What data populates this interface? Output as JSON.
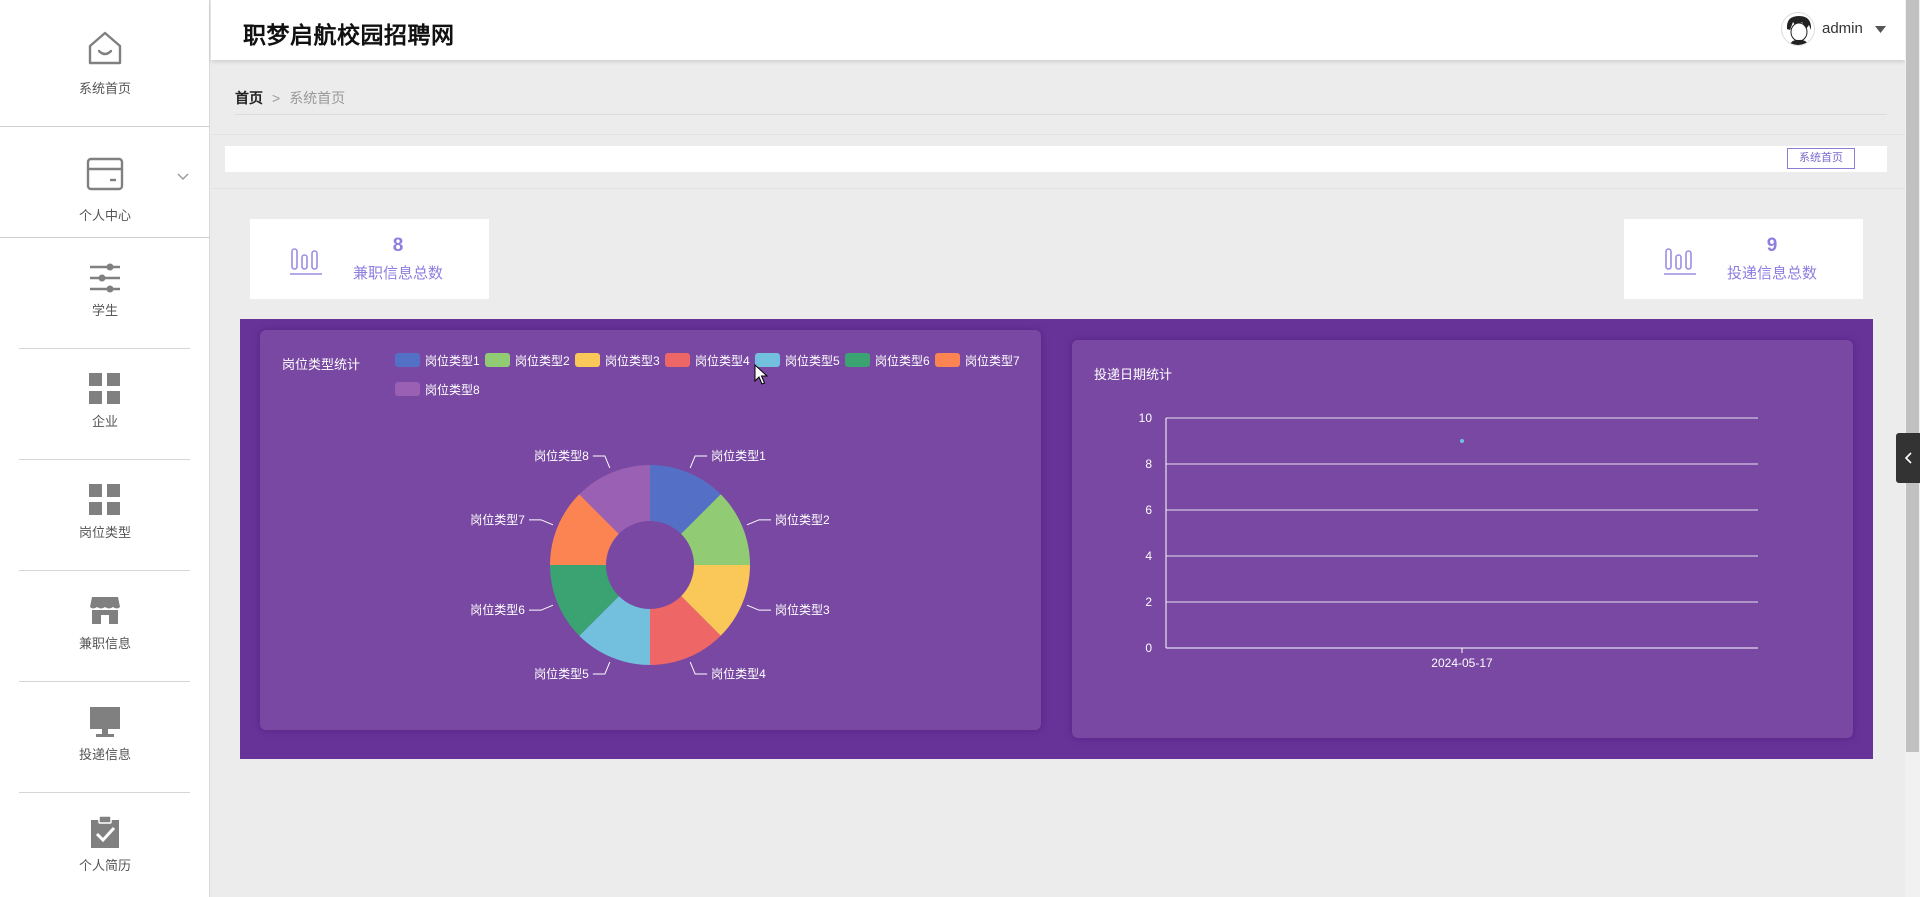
{
  "app": {
    "title": "职梦启航校园招聘网"
  },
  "user": {
    "name": "admin"
  },
  "sidebar": {
    "items": [
      {
        "label": "系统首页",
        "icon": "home-icon"
      },
      {
        "label": "个人中心",
        "icon": "wallet-icon"
      },
      {
        "label": "学生",
        "icon": "sliders-icon"
      },
      {
        "label": "企业",
        "icon": "grid-icon"
      },
      {
        "label": "岗位类型",
        "icon": "grid-icon"
      },
      {
        "label": "兼职信息",
        "icon": "store-icon"
      },
      {
        "label": "投递信息",
        "icon": "monitor-icon"
      },
      {
        "label": "个人简历",
        "icon": "clipboard-check-icon"
      }
    ]
  },
  "breadcrumb": {
    "home": "首页",
    "separator": ">",
    "current": "系统首页"
  },
  "tabs": {
    "active": "系统首页"
  },
  "stats": [
    {
      "value": "8",
      "label": "兼职信息总数",
      "icon": "bar-chart-icon"
    },
    {
      "value": "9",
      "label": "投递信息总数",
      "icon": "bar-chart-icon"
    }
  ],
  "colors": {
    "accent": "#8e7ee0",
    "chart_bg": "#673399",
    "panel_bg": "#7848a2"
  },
  "chart_data": [
    {
      "type": "pie",
      "title": "岗位类型统计",
      "donut": true,
      "legend_position": "top",
      "categories": [
        "岗位类型1",
        "岗位类型2",
        "岗位类型3",
        "岗位类型4",
        "岗位类型5",
        "岗位类型6",
        "岗位类型7",
        "岗位类型8"
      ],
      "values": [
        1,
        1,
        1,
        1,
        1,
        1,
        1,
        1
      ],
      "colors": [
        "#5470c6",
        "#91cc75",
        "#fac858",
        "#ee6666",
        "#73c0de",
        "#3ba272",
        "#fc8452",
        "#9a60b4"
      ]
    },
    {
      "type": "scatter",
      "title": "投递日期统计",
      "categories": [
        "2024-05-17"
      ],
      "values": [
        9
      ],
      "ylim": [
        0,
        10
      ],
      "yticks": [
        0,
        2,
        4,
        6,
        8,
        10
      ],
      "grid": true,
      "point_color": "#73c0de"
    }
  ]
}
